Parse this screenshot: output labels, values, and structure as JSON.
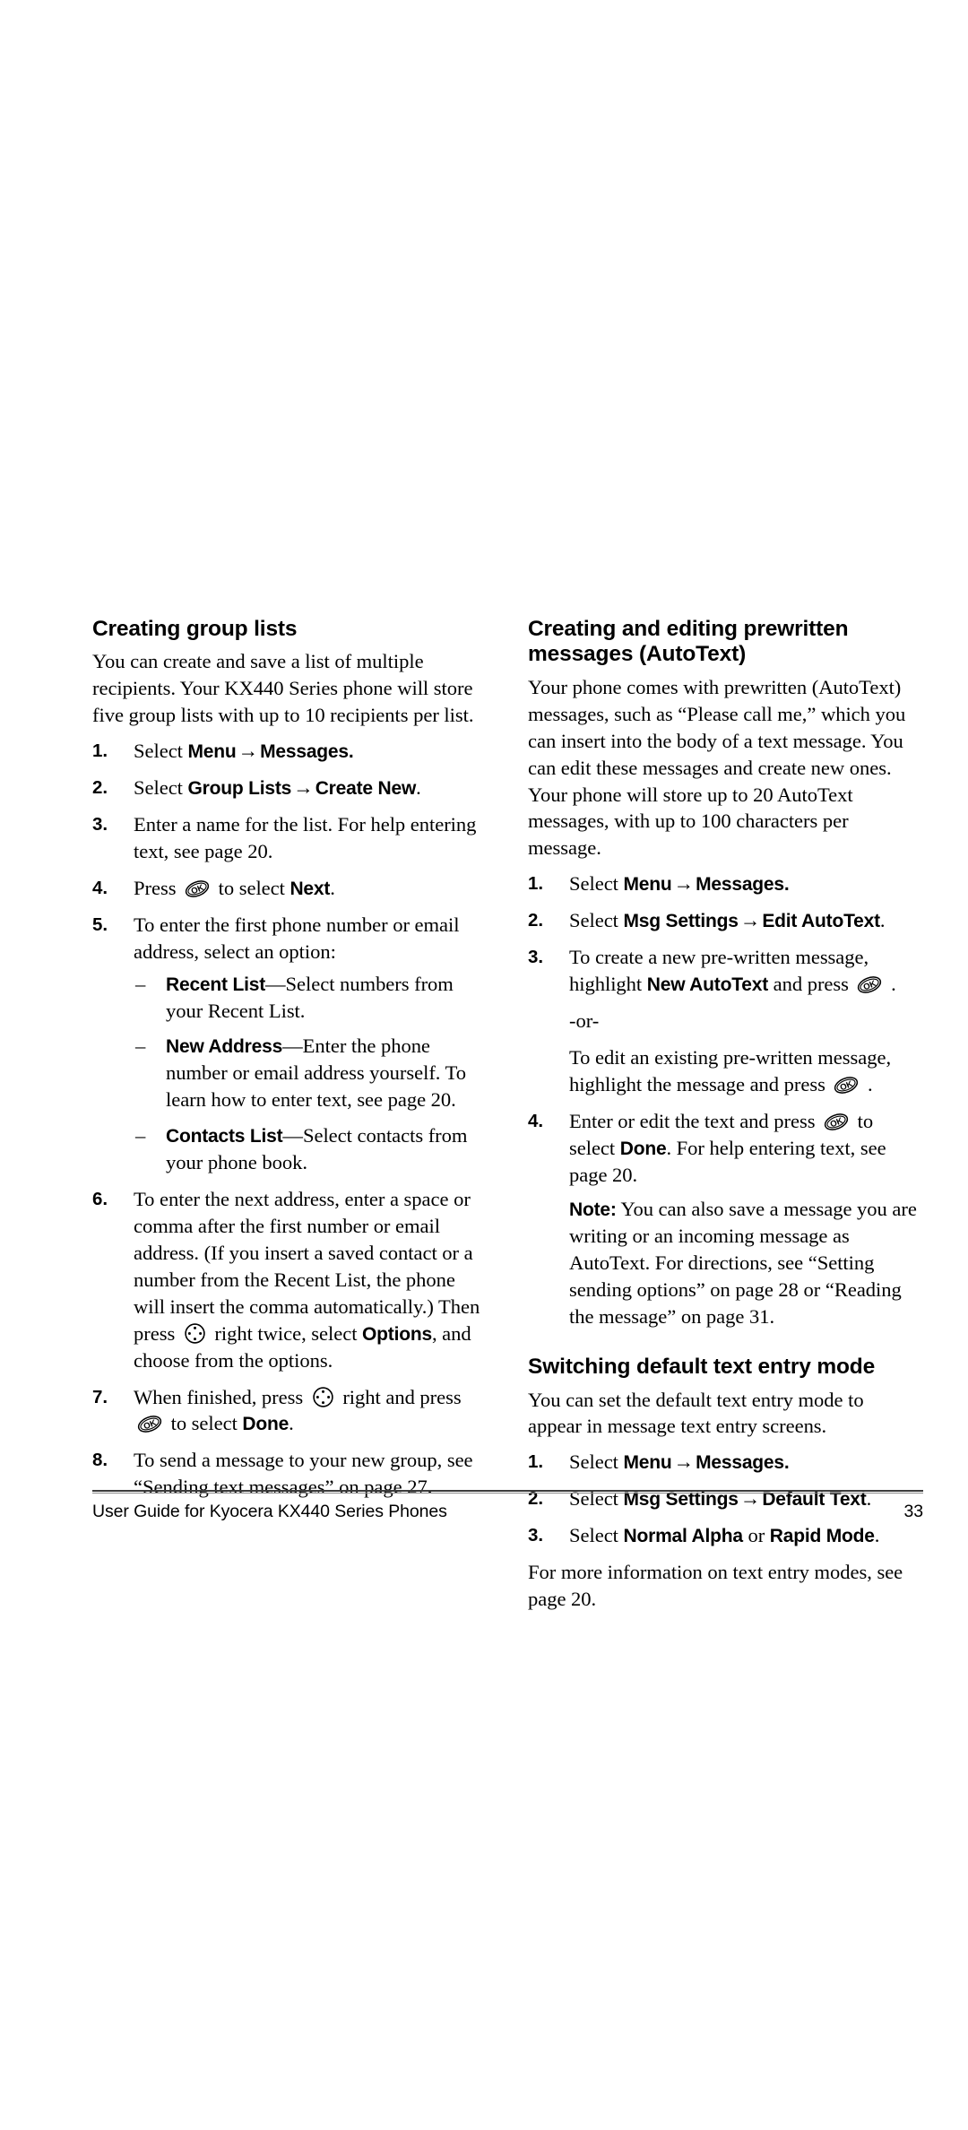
{
  "page": {
    "number": "33",
    "footer_text": "User Guide for Kyocera KX440 Series Phones"
  },
  "icons": {
    "ok_key": "ok-key-icon",
    "nav_key": "navigation-key-icon"
  },
  "left_column": {
    "heading": "Creating group lists",
    "intro": "You can create and save a list of multiple recipients. Your KX440 Series phone will store five group lists with up to 10 recipients per list.",
    "steps": [
      {
        "num": "1.",
        "pre": "Select ",
        "ui1": "Menu",
        "arrow": "→",
        "ui2": "Messages.",
        "post": ""
      },
      {
        "num": "2.",
        "pre": "Select ",
        "ui1": "Group Lists",
        "arrow": "→",
        "ui2": "Create New",
        "post": "."
      },
      {
        "num": "3.",
        "text": "Enter a name for the list. For help entering text, see page 20."
      },
      {
        "num": "4.",
        "pre": "Press ",
        "mid": " to select ",
        "ui2": "Next",
        "post": "."
      },
      {
        "num": "5.",
        "text": "To enter the first phone number or email address, select an option:",
        "subs": [
          {
            "dash": "–",
            "ui": "Recent List",
            "text": "—Select numbers from your Recent List."
          },
          {
            "dash": "–",
            "ui": "New Address",
            "text": "—Enter the phone number or email address yourself. To learn how to enter text, see page 20."
          },
          {
            "dash": "–",
            "ui": "Contacts List",
            "text": "—Select contacts from your phone book."
          }
        ]
      },
      {
        "num": "6.",
        "pre": "To enter the next address, enter a space or comma after the first number or email address. (If you insert a saved contact or a number from the Recent List, the phone will insert the comma automatically.) Then press ",
        "mid": " right twice, select ",
        "ui2": "Options",
        "post": ", and choose from the options."
      },
      {
        "num": "7.",
        "pre": "When finished, press ",
        "mid": " right and press ",
        "mid2": " to select ",
        "ui2": "Done",
        "post": "."
      },
      {
        "num": "8.",
        "text": "To send a message to your new group, see “Sending text messages” on page 27."
      }
    ]
  },
  "right_column": {
    "heading": "Creating and editing prewritten messages (AutoText)",
    "intro": "Your phone comes with prewritten (AutoText) messages, such as “Please call me,” which you can insert into the body of a text message. You can edit these messages and create new ones. Your phone will store up to 20 AutoText messages, with up to 100 characters per message.",
    "steps": [
      {
        "num": "1.",
        "pre": "Select ",
        "ui1": "Menu",
        "arrow": "→",
        "ui2": "Messages.",
        "post": ""
      },
      {
        "num": "2.",
        "pre": "Select ",
        "ui1": "Msg Settings",
        "arrow": "→",
        "ui2": "Edit AutoText",
        "post": "."
      },
      {
        "num": "3.",
        "pre": "To create a new pre-written message, highlight ",
        "ui1": "New AutoText",
        "mid": " and press ",
        "post": " .",
        "or_label": "-or-",
        "alt_pre": "To edit an existing pre-written message, highlight the message and press ",
        "alt_post": " ."
      },
      {
        "num": "4.",
        "pre": "Enter or edit the text and press ",
        "mid": " to select ",
        "ui2": "Done",
        "post": ". For help entering text, see page 20.",
        "note_label": "Note:",
        "note_text": "You can also save a message you are writing or an incoming message as AutoText. For directions, see “Setting sending options” on page 28 or “Reading the message” on page 31."
      }
    ],
    "heading2": "Switching default text entry mode",
    "intro2": "You can set the default text entry mode to appear in message text entry screens.",
    "steps2": [
      {
        "num": "1.",
        "pre": "Select ",
        "ui1": "Menu",
        "arrow": "→",
        "ui2": "Messages.",
        "post": ""
      },
      {
        "num": "2.",
        "pre": "Select ",
        "ui1": "Msg Settings",
        "arrow": "→",
        "ui2": "Default Text",
        "post": "."
      },
      {
        "num": "3.",
        "pre": "Select ",
        "ui1": "Normal Alpha",
        "conj": " or ",
        "ui2": "Rapid Mode",
        "post": "."
      }
    ],
    "closing": "For more information on text entry modes, see page 20."
  }
}
